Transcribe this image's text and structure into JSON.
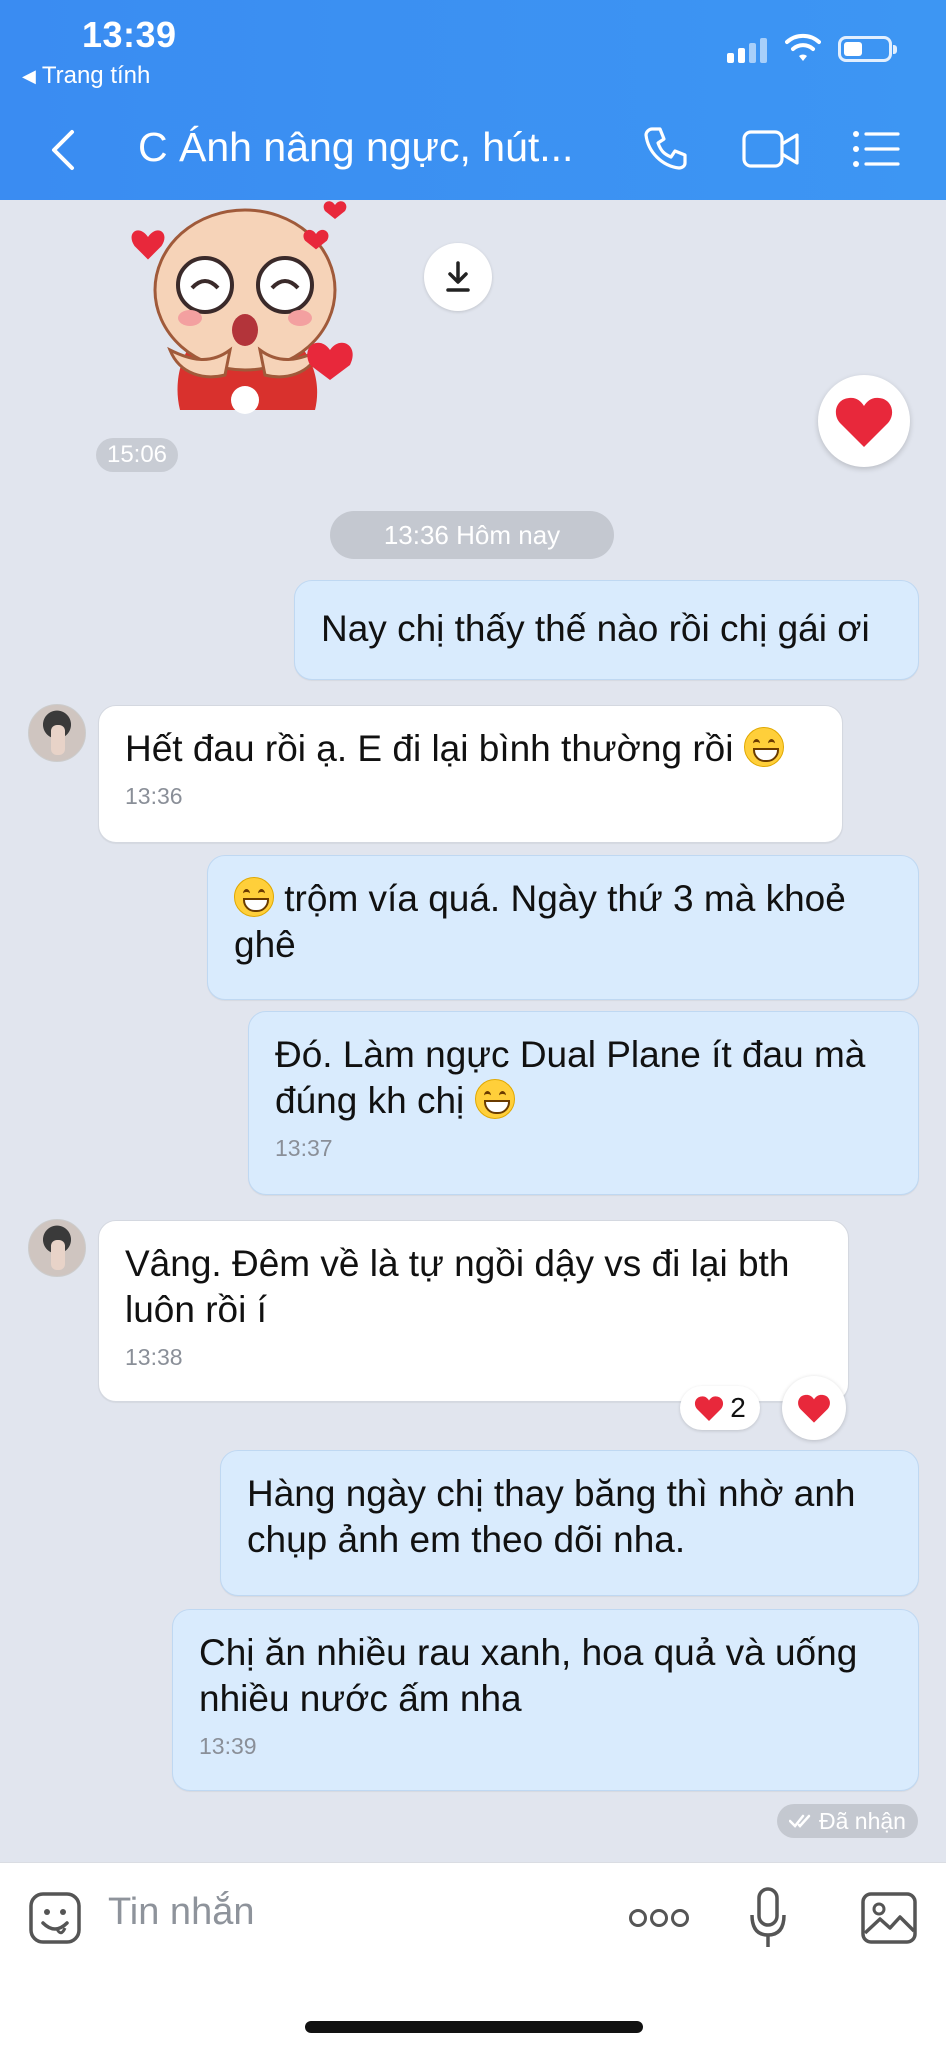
{
  "status": {
    "time": "13:39",
    "back_app": "Trang tính"
  },
  "header": {
    "title": "C Ánh nâng ngực, hút..."
  },
  "sticker": {
    "time": "15:06"
  },
  "date_separator": "13:36 Hôm nay",
  "messages": [
    {
      "id": "m1",
      "dir": "out",
      "text": "Nay chị thấy thế nào rồi chị gái ơi",
      "time": ""
    },
    {
      "id": "m2",
      "dir": "in",
      "text": "Hết đau rồi ạ. E đi lại bình thường rồi",
      "time": "13:36"
    },
    {
      "id": "m3",
      "dir": "out",
      "text_line1": "trộm vía quá. Ngày thứ 3 mà khoẻ",
      "text_line2": "ghê"
    },
    {
      "id": "m4",
      "dir": "out",
      "text_line1": "Đó. Làm ngực Dual Plane ít đau mà",
      "text_line2": "đúng kh chị",
      "time": "13:37"
    },
    {
      "id": "m5",
      "dir": "in",
      "text_line1": "Vâng. Đêm về là tự ngồi dậy vs đi lại bth",
      "text_line2": "luôn rồi í",
      "time": "13:38"
    },
    {
      "id": "m6",
      "dir": "out",
      "text_line1": "Hàng ngày chị thay băng thì nhờ anh",
      "text_line2": "chụp ảnh em theo dõi nha."
    },
    {
      "id": "m7",
      "dir": "out",
      "text_line1": "Chị ăn nhiều rau xanh, hoa quả và uống",
      "text_line2": "nhiều nước ấm nha",
      "time": "13:39"
    }
  ],
  "reaction": {
    "count": "2"
  },
  "delivery_status": "Đã nhận",
  "composer": {
    "placeholder": "Tin nhắn"
  },
  "icons": [
    "back-triangle-icon",
    "signal-icon",
    "wifi-icon",
    "battery-icon",
    "back-chevron-icon",
    "phone-icon",
    "video-icon",
    "menu-icon",
    "download-icon",
    "heart-icon",
    "emoji-icon",
    "more-icon",
    "mic-icon",
    "image-icon"
  ],
  "colors": {
    "header": "#3a8cf2",
    "background": "#e1e5ee",
    "outgoing_bubble": "#d9ebfd",
    "incoming_bubble": "#ffffff",
    "heart": "#e8283b"
  }
}
